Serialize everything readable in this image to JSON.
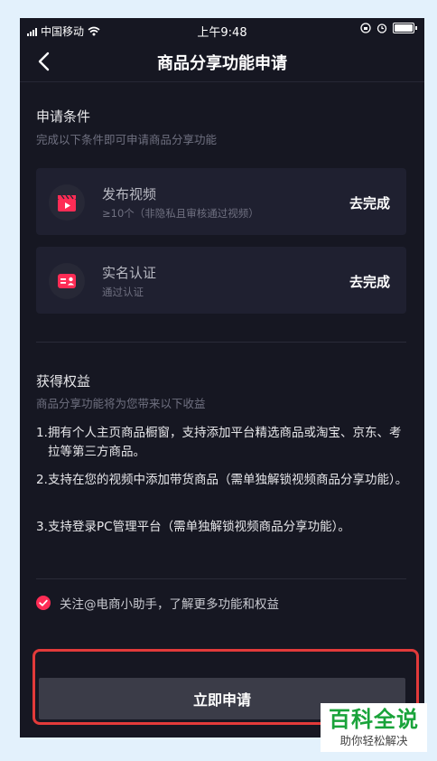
{
  "status_bar": {
    "carrier": "中国移动",
    "time": "上午9:48"
  },
  "header": {
    "title": "商品分享功能申请",
    "back_icon": "back-arrow-icon"
  },
  "conditions": {
    "title": "申请条件",
    "subtitle": "完成以下条件即可申请商品分享功能",
    "items": [
      {
        "name": "发布视频",
        "desc": "≥10个（非隐私且审核通过视频）",
        "action": "去完成",
        "icon": "video-clapper-icon"
      },
      {
        "name": "实名认证",
        "desc": "通过认证",
        "action": "去完成",
        "icon": "id-card-icon"
      }
    ]
  },
  "benefits": {
    "title": "获得权益",
    "subtitle": "商品分享功能将为您带来以下收益",
    "items": [
      {
        "num": "1.",
        "text": "拥有个人主页商品橱窗，支持添加平台精选商品或淘宝、京东、考拉等第三方商品。"
      },
      {
        "num": "2.",
        "text": "支持在您的视频中添加带货商品（需单独解锁视频商品分享功能）。"
      },
      {
        "num": "3.",
        "text": "支持登录PC管理平台（需单独解锁视频商品分享功能）。"
      }
    ]
  },
  "follow": {
    "checked": true,
    "text": "关注@电商小助手，了解更多功能和权益"
  },
  "apply_button": {
    "label": "立即申请"
  },
  "watermark": {
    "main": "百科全说",
    "sub": "助你轻松解决"
  },
  "colors": {
    "background": "#161722",
    "card": "#1f2030",
    "accent": "#fe2c55",
    "button": "#3b3c48",
    "highlight": "#e23a3a",
    "watermark_green": "#19a33a"
  }
}
